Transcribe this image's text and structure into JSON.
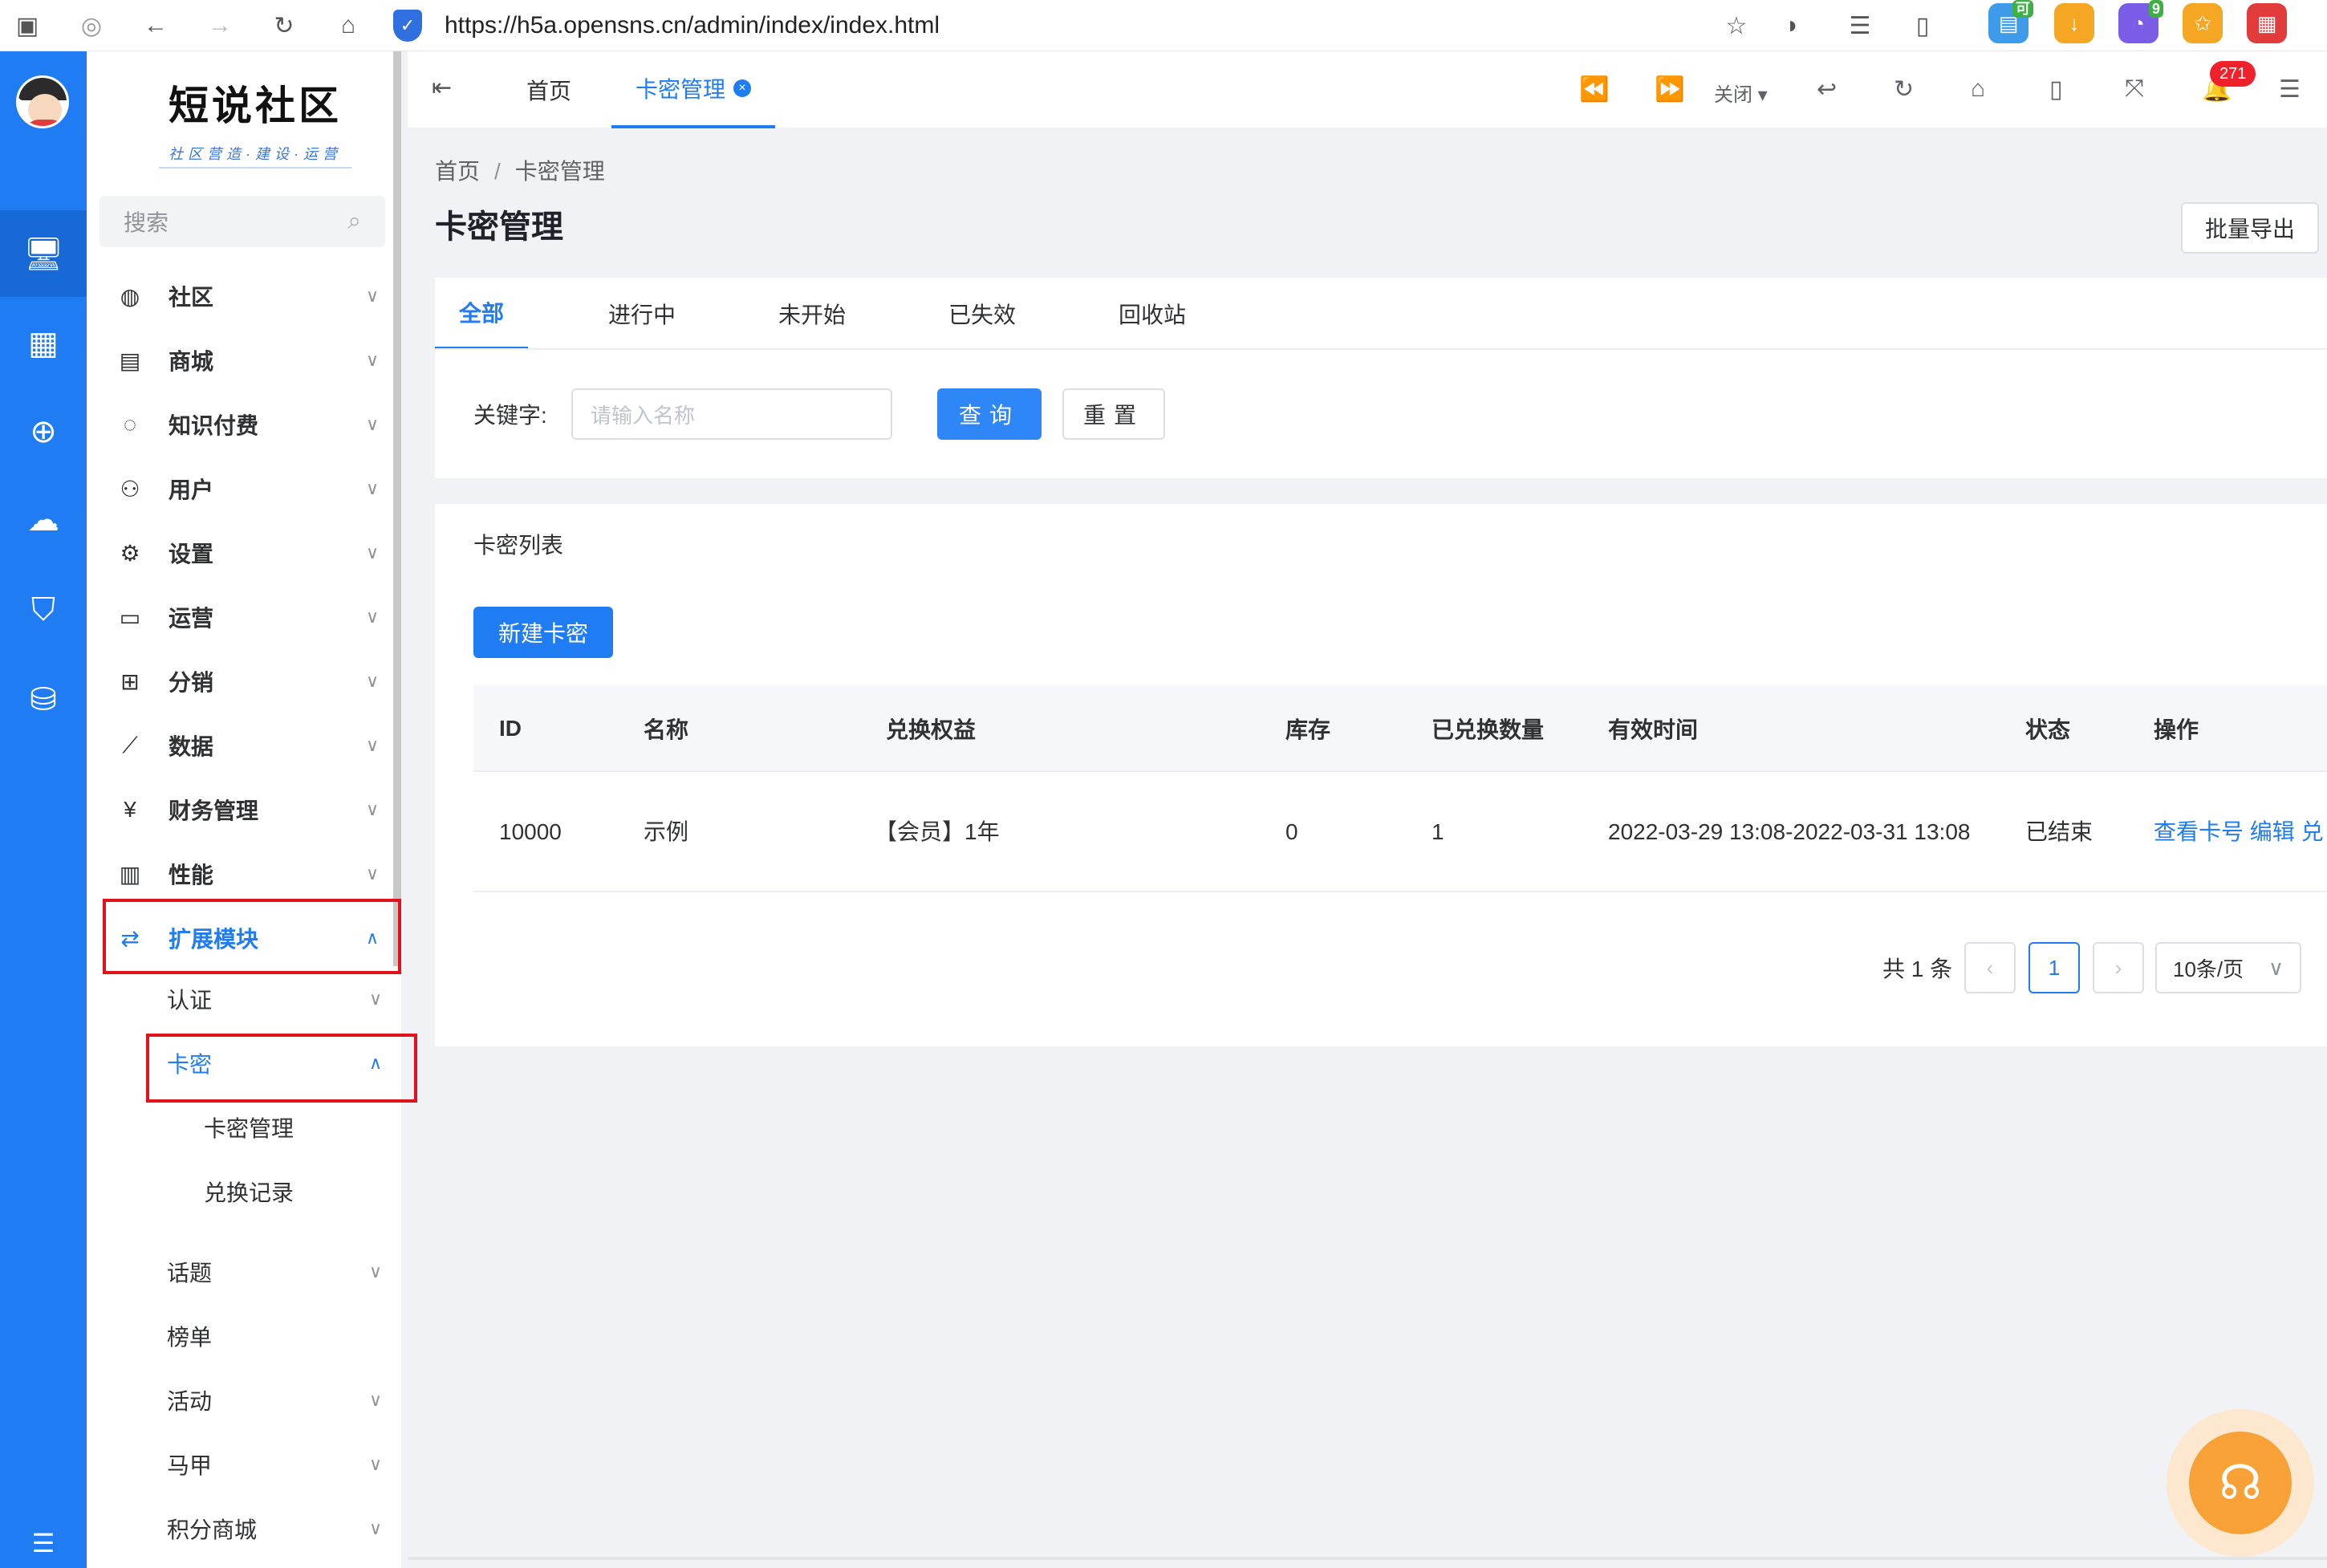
{
  "browser": {
    "url": "https://h5a.opensns.cn/admin/index/index.html",
    "ext_badge_1": "可",
    "ext_badge_2": "9"
  },
  "sidebar": {
    "brand": "短说社区",
    "slogan": "社区营造·建设·运营",
    "search_placeholder": "搜索",
    "items": [
      {
        "label": "社区",
        "icon": "chat-icon"
      },
      {
        "label": "商城",
        "icon": "store-icon"
      },
      {
        "label": "知识付费",
        "icon": "bulb-icon"
      },
      {
        "label": "用户",
        "icon": "user-icon"
      },
      {
        "label": "设置",
        "icon": "gear-icon"
      },
      {
        "label": "运营",
        "icon": "presentation-icon"
      },
      {
        "label": "分销",
        "icon": "org-icon"
      },
      {
        "label": "数据",
        "icon": "chart-icon"
      },
      {
        "label": "财务管理",
        "icon": "finance-icon"
      },
      {
        "label": "性能",
        "icon": "doc-icon"
      },
      {
        "label": "扩展模块",
        "icon": "extend-icon"
      }
    ],
    "sub_items": {
      "auth": "认证",
      "card": "卡密",
      "card_manage": "卡密管理",
      "redeem_log": "兑换记录",
      "topic": "话题",
      "rank": "榜单",
      "activity": "活动",
      "vest": "马甲",
      "points_mall": "积分商城"
    }
  },
  "tabbar": {
    "tabs": [
      {
        "label": "首页"
      },
      {
        "label": "卡密管理"
      }
    ],
    "close_label": "关闭",
    "notify_count": "271"
  },
  "page": {
    "breadcrumb": [
      "首页",
      "卡密管理"
    ],
    "breadcrumb_sep": "/",
    "title": "卡密管理",
    "export_label": "批量导出"
  },
  "filter": {
    "tabs": [
      "全部",
      "进行中",
      "未开始",
      "已失效",
      "回收站"
    ],
    "keyword_label": "关键字:",
    "keyword_placeholder": "请输入名称",
    "query_label": "查询",
    "reset_label": "重置"
  },
  "list": {
    "title": "卡密列表",
    "new_label": "新建卡密",
    "columns": [
      "ID",
      "名称",
      "兑换权益",
      "库存",
      "已兑换数量",
      "有效时间",
      "状态",
      "操作"
    ],
    "rows": [
      {
        "id": "10000",
        "name": "示例",
        "benefit": "【会员】1年",
        "stock": "0",
        "redeemed": "1",
        "valid_time": "2022-03-29 13:08-2022-03-31 13:08",
        "status": "已结束",
        "actions": [
          "查看卡号",
          "编辑",
          "兑"
        ]
      }
    ],
    "pagination": {
      "total_text": "共 1 条",
      "current_page": "1",
      "page_size": "10条/页"
    }
  },
  "colors": {
    "primary": "#1f7cf3",
    "highlight_box": "#e0121b",
    "rail": "#1f7cf3"
  }
}
